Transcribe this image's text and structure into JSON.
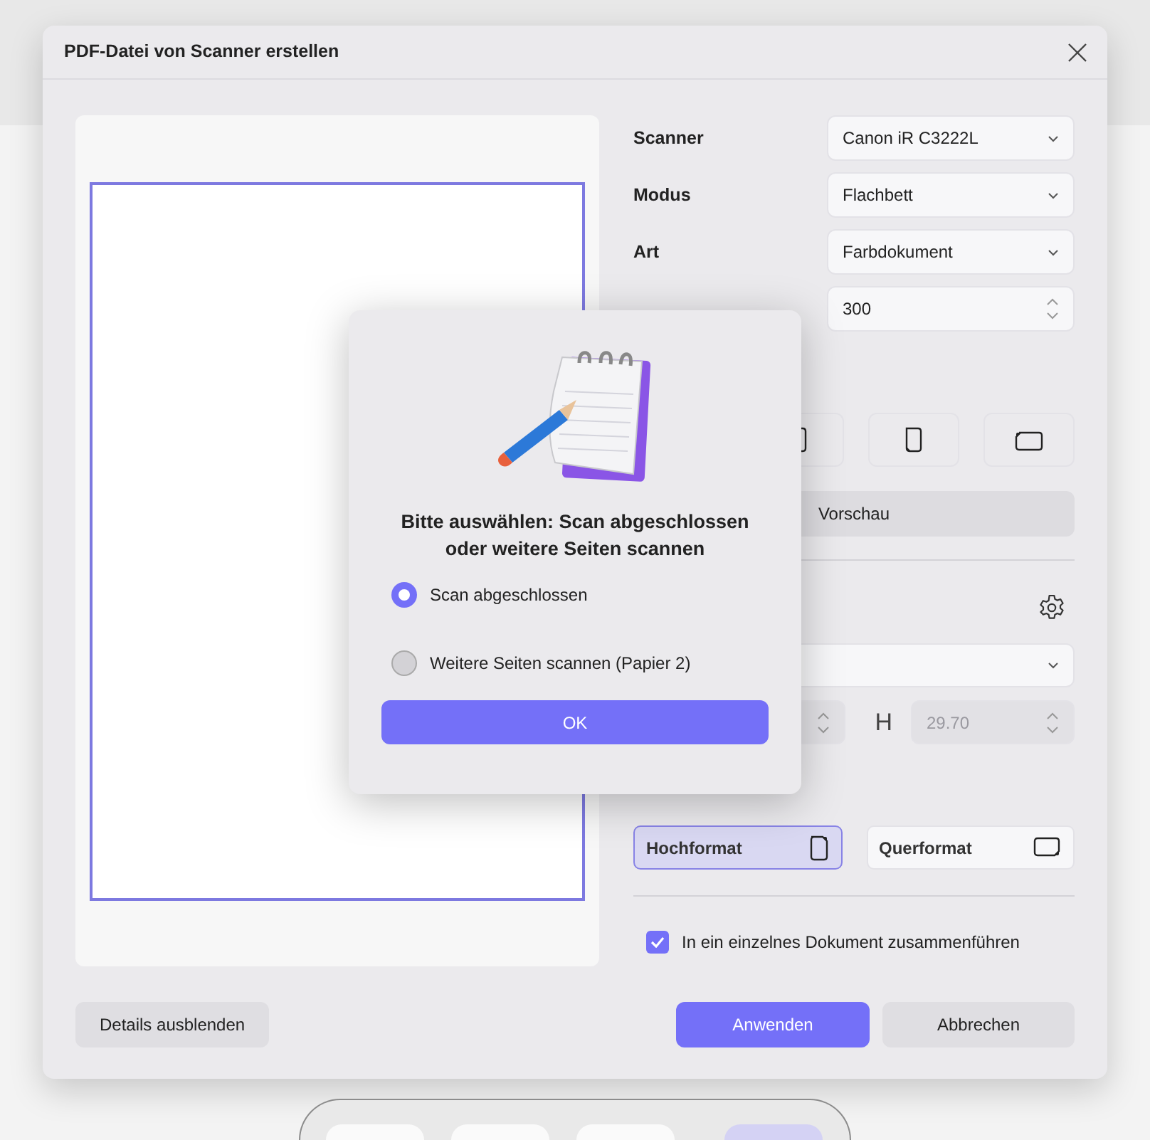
{
  "dialog": {
    "title": "PDF-Datei von Scanner erstellen"
  },
  "settings": [
    {
      "label": "Scanner",
      "value": "Canon iR C3222L",
      "kind": "select"
    },
    {
      "label": "Modus",
      "value": "Flachbett",
      "kind": "select"
    },
    {
      "label": "Art",
      "value": "Farbdokument",
      "kind": "select"
    },
    {
      "value": "300",
      "kind": "spinner"
    }
  ],
  "preview_button": "Vorschau",
  "size": {
    "height_label": "H",
    "height_value": "29.70",
    "disabled": true
  },
  "orientation": [
    {
      "label": "Hochformat",
      "selected": true
    },
    {
      "label": "Querformat",
      "selected": false
    }
  ],
  "merge": {
    "label": "In ein einzelnes Dokument zusammenführen",
    "checked": true
  },
  "footer_left": [
    {
      "label": "Details ausblenden",
      "kind": "secondary"
    }
  ],
  "footer_right": [
    {
      "label": "Anwenden",
      "kind": "primary"
    },
    {
      "label": "Abbrechen",
      "kind": "secondary"
    }
  ],
  "prompt": {
    "title": "Bitte auswählen: Scan abgeschlossen oder weitere Seiten scannen",
    "options": [
      {
        "label": "Scan abgeschlossen",
        "selected": true
      },
      {
        "label": "Weitere Seiten scannen (Papier 2)",
        "selected": false
      }
    ],
    "ok": "OK"
  }
}
